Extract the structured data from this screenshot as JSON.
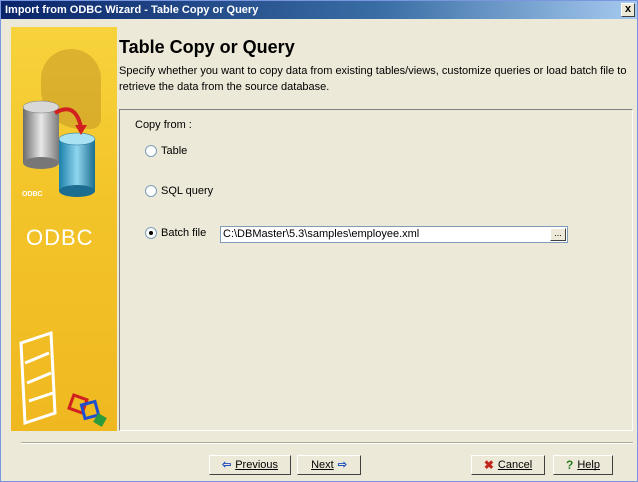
{
  "window": {
    "title": "Import from ODBC Wizard - Table Copy or Query",
    "close_glyph": "x"
  },
  "header": {
    "title": "Table Copy or Query",
    "description": "Specify whether you want to copy data from existing tables/views, customize queries or load batch file to retrieve the data from the source database."
  },
  "side_panel": {
    "logo_text": "ODBC",
    "small_label": "ODBC"
  },
  "copy_from": {
    "label": "Copy from :",
    "options": [
      {
        "label": "Table",
        "selected": false
      },
      {
        "label": "SQL query",
        "selected": false
      },
      {
        "label": "Batch file",
        "selected": true
      }
    ],
    "batch_file_path": "C:\\DBMaster\\5.3\\samples\\employee.xml",
    "browse_label": "..."
  },
  "buttons": {
    "previous": "Previous",
    "next": "Next",
    "cancel": "Cancel",
    "help": "Help"
  },
  "colors": {
    "title_bar_start": "#0a246a",
    "side_panel": "#f3c52a",
    "dialog_bg": "#ece9d8"
  }
}
